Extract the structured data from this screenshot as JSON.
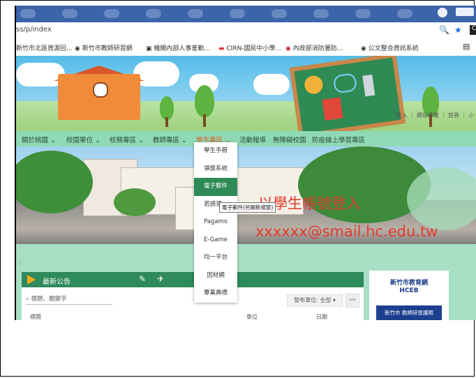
{
  "browser": {
    "url": "ss/p/index",
    "bookmarks": [
      "新竹市北區資源回...",
      "新竹市教師研習網",
      "機關內部人事差勤...",
      "CIRN-國民中小學...",
      "內政部消防署防...",
      "公文整合資訊系統"
    ]
  },
  "header": {
    "links": "登入 ｜ 網站導覽 ｜ 首頁 ｜ 小"
  },
  "nav": {
    "items": [
      "關於桃園",
      "校園單位",
      "校務專區",
      "教師專區",
      "學生專區",
      "活動報導",
      "無障礙校園",
      "防疫線上學習專區"
    ]
  },
  "dropdown": {
    "items": [
      "學生手冊",
      "領獎系統",
      "電子郵件",
      "若語領...",
      "Pagamo",
      "E-Game",
      "均一平台",
      "因材網",
      "畢業典禮"
    ],
    "tooltip": "電子郵件(另開新視窗)"
  },
  "overlay": {
    "login_text": "以學生帳號登入",
    "email_text": "xxxxxx@smail.hc.edu.tw"
  },
  "news": {
    "title": "最新公告",
    "search_placeholder": "標題、關鍵字",
    "filter_label": "發布單位: 全部",
    "columns": [
      "標題",
      "單位",
      "日期"
    ]
  },
  "sidebar_banner": {
    "line1": "新竹市教育網",
    "line2": "HCEB",
    "bar": "新竹市 教師研習護照"
  },
  "colors": {
    "nav_bg": "#8fd9b6",
    "active_nav": "#e05a20",
    "highlight": "#2e8b57",
    "overlay_text": "#e03b2e"
  }
}
